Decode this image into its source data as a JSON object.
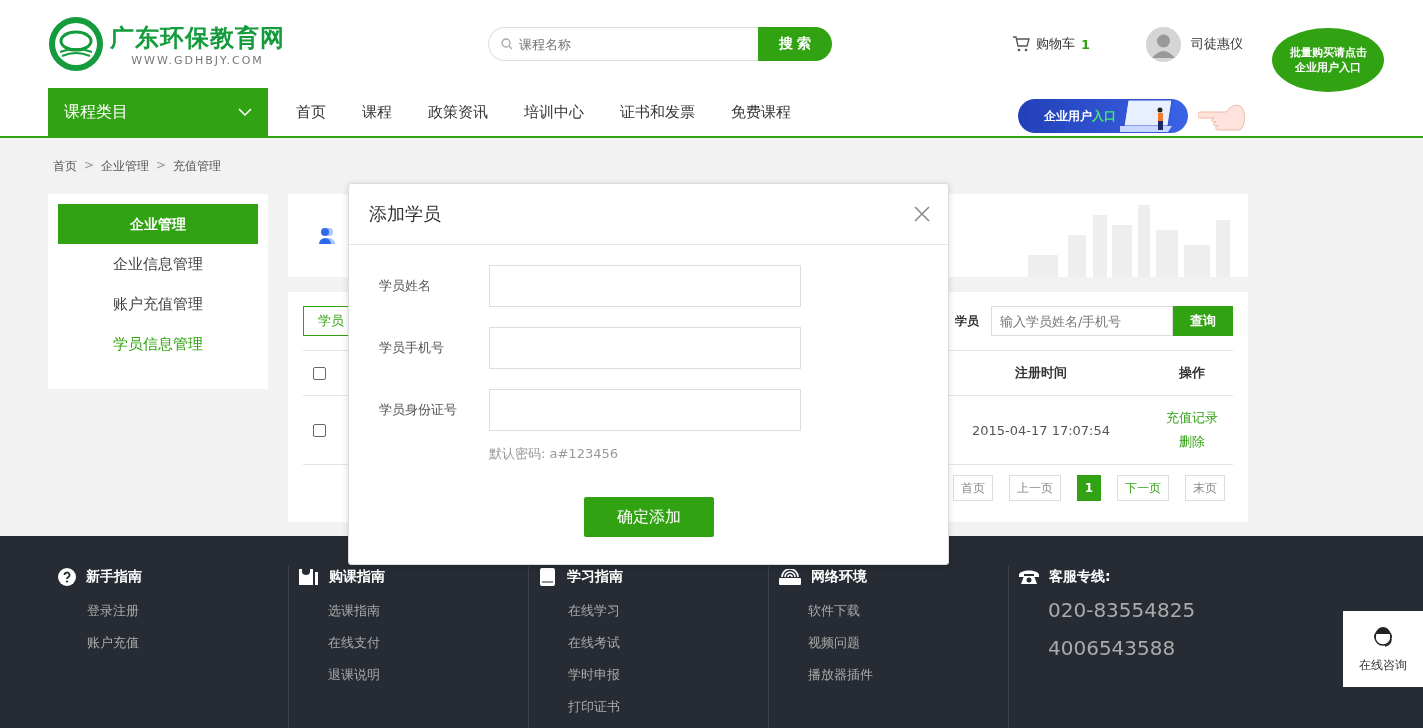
{
  "header": {
    "site_name": "广东环保教育网",
    "site_url": "WWW.GDHBJY.COM",
    "search": {
      "placeholder": "课程名称",
      "button": "搜 索"
    },
    "cart": {
      "label": "购物车",
      "count": "1"
    },
    "user": {
      "name": "司徒惠仪"
    },
    "promo_bubble": [
      "批量购买请点击",
      "企业用户入口"
    ],
    "enterprise_banner": {
      "label": "企业用户",
      "highlight": "入口"
    }
  },
  "nav": {
    "category": "课程类目",
    "items": [
      {
        "label": "首页",
        "selected": false
      },
      {
        "label": "课程",
        "selected": false
      },
      {
        "label": "政策资讯",
        "selected": false
      },
      {
        "label": "培训中心",
        "selected": false
      },
      {
        "label": "证书和发票",
        "selected": false
      },
      {
        "label": "免费课程",
        "selected": false
      }
    ]
  },
  "breadcrumb": [
    {
      "kind": "link",
      "label": "首页"
    },
    {
      "kind": "separator",
      "label": ">"
    },
    {
      "kind": "link",
      "label": "企业管理"
    },
    {
      "kind": "separator",
      "label": ">"
    },
    {
      "kind": "link",
      "label": "充值管理"
    }
  ],
  "sidebar": {
    "title": "企业管理",
    "items": [
      {
        "label": "企业信息管理",
        "selected": false
      },
      {
        "label": "账户充值管理",
        "selected": false
      },
      {
        "label": "学员信息管理",
        "selected": true
      }
    ]
  },
  "toolbar": {
    "tab_label": "学员",
    "filter_label": "学员",
    "search_placeholder": "输入学员姓名/手机号",
    "search_button": "查询"
  },
  "table": {
    "columns": [
      "注册时间",
      "操作"
    ],
    "header_checked": false,
    "rows": [
      {
        "checked": false,
        "registered": "2015-04-17 17:07:54",
        "actions": [
          "充值记录",
          "删除"
        ]
      }
    ]
  },
  "pagination": [
    {
      "label": "首页",
      "kind": "nav",
      "selected": false
    },
    {
      "label": "上一页",
      "kind": "nav",
      "selected": false
    },
    {
      "label": "1",
      "kind": "page",
      "selected": true
    },
    {
      "label": "下一页",
      "kind": "next",
      "selected": false
    },
    {
      "label": "末页",
      "kind": "nav",
      "selected": false
    }
  ],
  "modal": {
    "title": "添加学员",
    "fields": [
      {
        "label": "学员姓名"
      },
      {
        "label": "学员手机号"
      },
      {
        "label": "学员身份证号"
      }
    ],
    "hint": "默认密码: a#123456",
    "submit": "确定添加"
  },
  "footer": {
    "columns": [
      {
        "title": "新手指南",
        "links": [
          "登录注册",
          "账户充值"
        ]
      },
      {
        "title": "购课指南",
        "links": [
          "选课指南",
          "在线支付",
          "退课说明"
        ]
      },
      {
        "title": "学习指南",
        "links": [
          "在线学习",
          "在线考试",
          "学时申报",
          "打印证书"
        ]
      },
      {
        "title": "网络环境",
        "links": [
          "软件下载",
          "视频问题",
          "播放器插件"
        ]
      }
    ],
    "hotline": {
      "title": "客服专线:",
      "numbers": [
        "020-83554825",
        "4006543588"
      ]
    }
  },
  "consult": {
    "label": "在线咨询"
  }
}
